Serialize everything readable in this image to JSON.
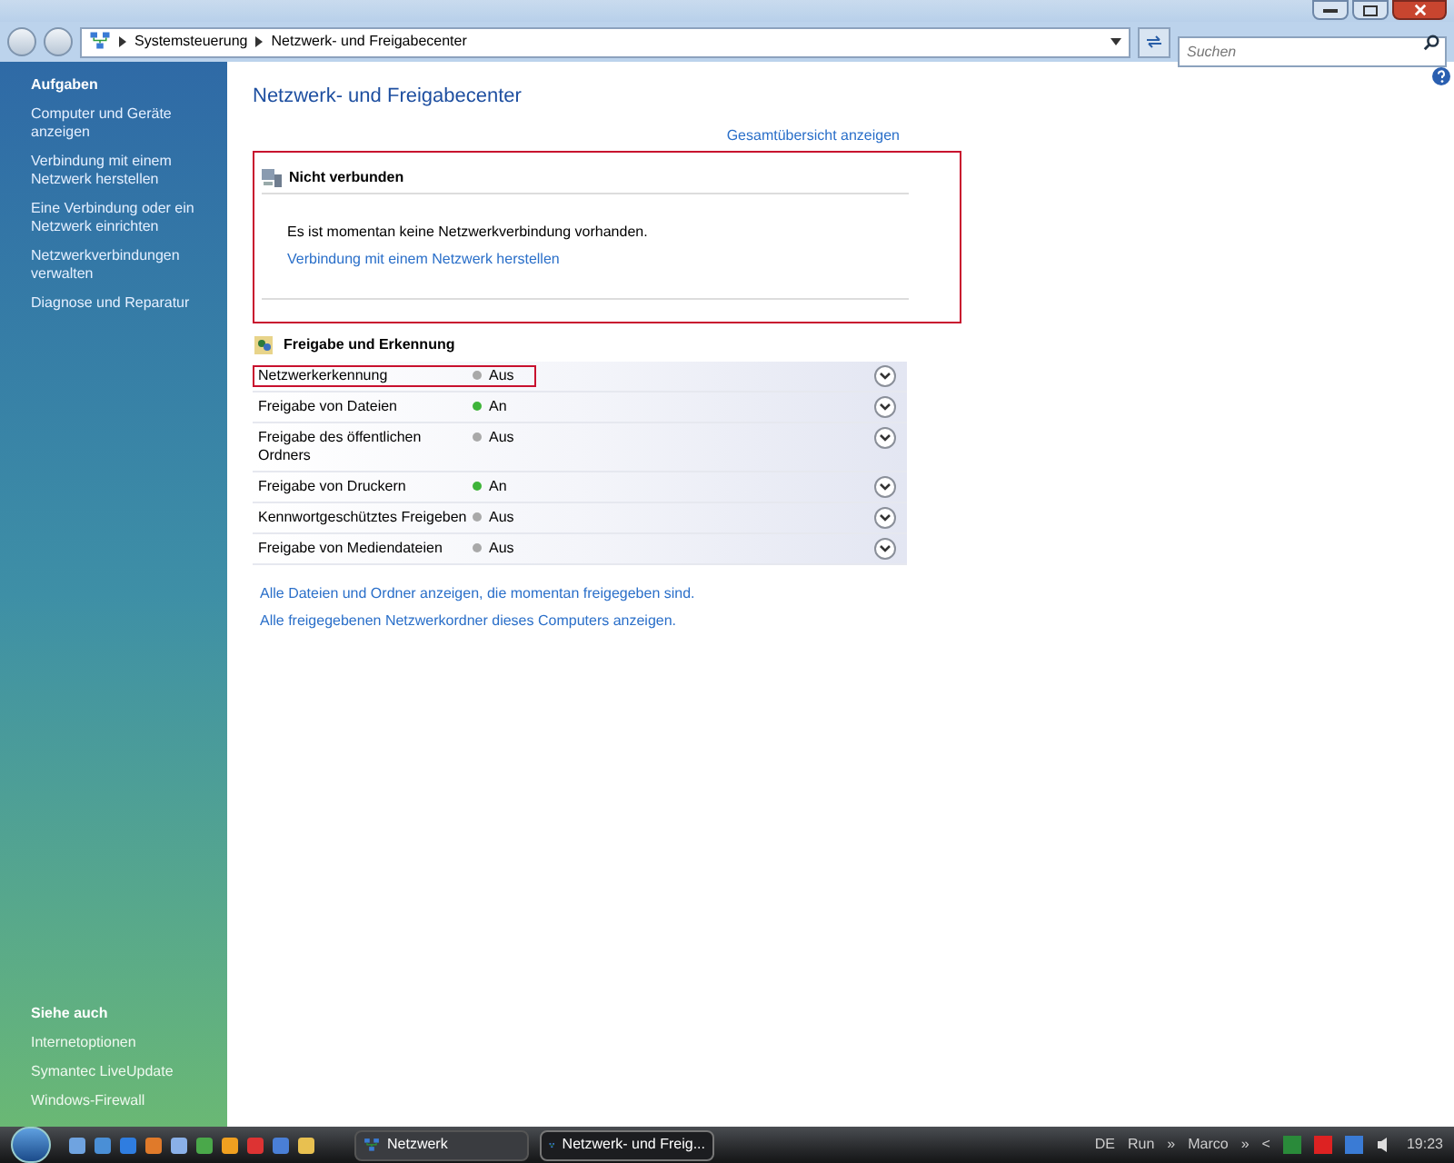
{
  "address_bar": {
    "crumbs": [
      "Systemsteuerung",
      "Netzwerk- und Freigabecenter"
    ]
  },
  "search": {
    "placeholder": "Suchen"
  },
  "sidebar": {
    "tasks_title": "Aufgaben",
    "tasks": [
      "Computer und Geräte anzeigen",
      "Verbindung mit einem Netzwerk herstellen",
      "Eine Verbindung oder ein Netzwerk einrichten",
      "Netzwerkverbindungen verwalten",
      "Diagnose und Reparatur"
    ],
    "see_also_title": "Siehe auch",
    "see_also": [
      "Internetoptionen",
      "Symantec LiveUpdate",
      "Windows-Firewall"
    ]
  },
  "page_title": "Netzwerk- und Freigabecenter",
  "overview_link": "Gesamtübersicht anzeigen",
  "connection": {
    "title": "Nicht verbunden",
    "message": "Es ist momentan keine Netzwerkverbindung vorhanden.",
    "link": "Verbindung mit einem Netzwerk herstellen",
    "highlighted": true
  },
  "sharing": {
    "title": "Freigabe und Erkennung",
    "rows": [
      {
        "label": "Netzwerkerkennung",
        "status": "Aus",
        "on": false,
        "highlighted": true
      },
      {
        "label": "Freigabe von Dateien",
        "status": "An",
        "on": true,
        "highlighted": false
      },
      {
        "label": "Freigabe des öffentlichen Ordners",
        "status": "Aus",
        "on": false,
        "highlighted": false
      },
      {
        "label": "Freigabe von Druckern",
        "status": "An",
        "on": true,
        "highlighted": false
      },
      {
        "label": "Kennwortgeschütztes Freigeben",
        "status": "Aus",
        "on": false,
        "highlighted": false
      },
      {
        "label": "Freigabe von Mediendateien",
        "status": "Aus",
        "on": false,
        "highlighted": false
      }
    ]
  },
  "links": [
    "Alle Dateien und Ordner anzeigen, die momentan freigegeben sind.",
    "Alle freigegebenen Netzwerkordner dieses Computers anzeigen."
  ],
  "taskbar": {
    "buttons": [
      {
        "label": "Netzwerk",
        "selected": false
      },
      {
        "label": "Netzwerk- und Freig...",
        "selected": true
      }
    ],
    "tray": [
      "DE",
      "Run",
      "»",
      "Marco",
      "»",
      "<"
    ],
    "clock": "19:23"
  }
}
